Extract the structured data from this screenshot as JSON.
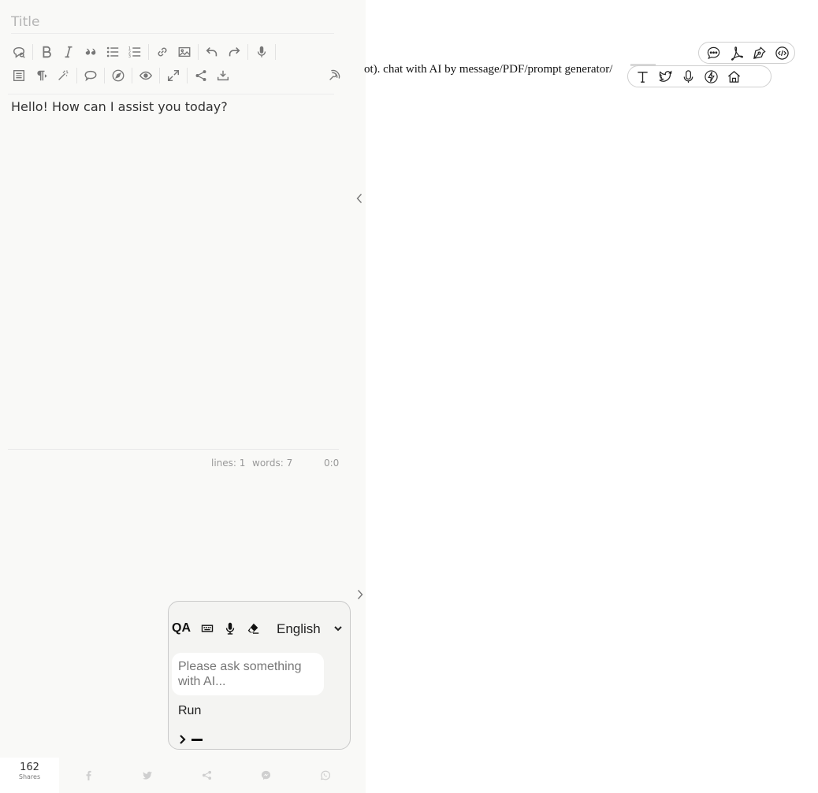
{
  "editor": {
    "title_placeholder": "Title",
    "content": "Hello! How can I assist you today?",
    "status": {
      "lines": "lines: 1",
      "words": "words: 7",
      "cursor": "0:0"
    }
  },
  "toolbar": {
    "row1": [
      "search-replace",
      "bold",
      "italic",
      "quote",
      "unordered-list",
      "ordered-list",
      "link",
      "image",
      "undo",
      "redo",
      "voice-input"
    ],
    "row2": [
      "preview-pane",
      "paragraph",
      "magic",
      "chat",
      "explore",
      "eye",
      "fullscreen",
      "share",
      "download",
      "broadcast"
    ]
  },
  "ai_widget": {
    "mode_label": "QA",
    "language_options": [
      "English"
    ],
    "language_selected": "English",
    "input_placeholder": "Please ask something with AI...",
    "run_label": "Run"
  },
  "share_bar": {
    "count": "162",
    "count_label": "Shares",
    "buttons": [
      "facebook",
      "twitter",
      "share",
      "messenger",
      "whatsapp"
    ]
  },
  "page": {
    "text": "ot). chat with AI by message/PDF/prompt generator/"
  },
  "floating_toolbars": {
    "top": [
      "chat-bubble-icon",
      "pdf-icon",
      "pen-nib-icon",
      "code-icon"
    ],
    "bottom": [
      "text-icon",
      "twitter-icon",
      "microphone-icon",
      "lightning-icon",
      "home-icon"
    ]
  },
  "colors": {
    "editor_bg": "#f9f9f7",
    "icon_gray": "#777777",
    "widget_border": "#c9c9c9"
  }
}
